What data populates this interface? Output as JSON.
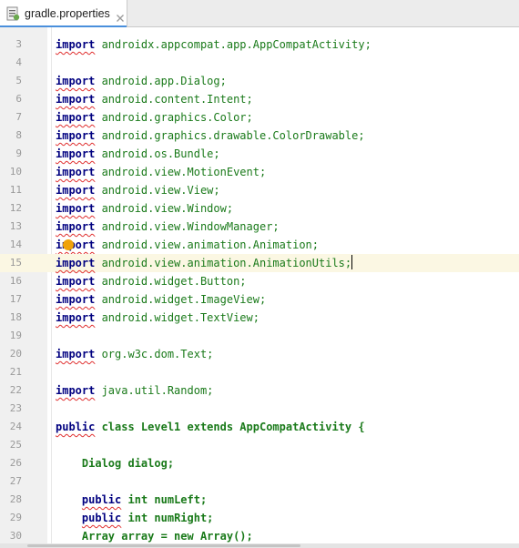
{
  "tab": {
    "label": "gradle.properties",
    "icon": "properties-file-icon",
    "close_icon": "close-icon"
  },
  "colors": {
    "keyword": "#000080",
    "package": "#1a7a1a",
    "error_underline": "#e03030",
    "current_line": "#fbf7e3",
    "intention_bulb": "#f0a30a",
    "tab_accent": "#4a8fdc"
  },
  "editor": {
    "current_line": 15,
    "lines": [
      {
        "num": "3",
        "kw": "import",
        "rest": " androidx.appcompat.app.AppCompatActivity;"
      },
      {
        "num": "4",
        "kw": "",
        "rest": ""
      },
      {
        "num": "5",
        "kw": "import",
        "rest": " android.app.Dialog;"
      },
      {
        "num": "6",
        "kw": "import",
        "rest": " android.content.Intent;"
      },
      {
        "num": "7",
        "kw": "import",
        "rest": " android.graphics.Color;"
      },
      {
        "num": "8",
        "kw": "import",
        "rest": " android.graphics.drawable.ColorDrawable;"
      },
      {
        "num": "9",
        "kw": "import",
        "rest": " android.os.Bundle;"
      },
      {
        "num": "10",
        "kw": "import",
        "rest": " android.view.MotionEvent;"
      },
      {
        "num": "11",
        "kw": "import",
        "rest": " android.view.View;"
      },
      {
        "num": "12",
        "kw": "import",
        "rest": " android.view.Window;"
      },
      {
        "num": "13",
        "kw": "import",
        "rest": " android.view.WindowManager;"
      },
      {
        "num": "14",
        "kw": "import",
        "rest": " android.view.animation.Animation;"
      },
      {
        "num": "15",
        "kw": "import",
        "rest": " android.view.animation.AnimationUtils;"
      },
      {
        "num": "16",
        "kw": "import",
        "rest": " android.widget.Button;"
      },
      {
        "num": "17",
        "kw": "import",
        "rest": " android.widget.ImageView;"
      },
      {
        "num": "18",
        "kw": "import",
        "rest": " android.widget.TextView;"
      },
      {
        "num": "19",
        "kw": "",
        "rest": ""
      },
      {
        "num": "20",
        "kw": "import",
        "rest": " org.w3c.dom.Text;"
      },
      {
        "num": "21",
        "kw": "",
        "rest": ""
      },
      {
        "num": "22",
        "kw": "import",
        "rest": " java.util.Random;"
      },
      {
        "num": "23",
        "kw": "",
        "rest": ""
      },
      {
        "num": "24",
        "kw": "public",
        "rest": " class Level1 extends AppCompatActivity {"
      },
      {
        "num": "25",
        "kw": "",
        "rest": ""
      },
      {
        "num": "26",
        "kw": "",
        "rest": "    Dialog dialog;"
      },
      {
        "num": "27",
        "kw": "",
        "rest": ""
      },
      {
        "num": "28",
        "kw": "public",
        "rest": " int numLeft;",
        "indent": "    "
      },
      {
        "num": "29",
        "kw": "public",
        "rest": " int numRight;",
        "indent": "    "
      },
      {
        "num": "30",
        "kw": "",
        "rest": "    Array array = new Array();"
      }
    ]
  }
}
